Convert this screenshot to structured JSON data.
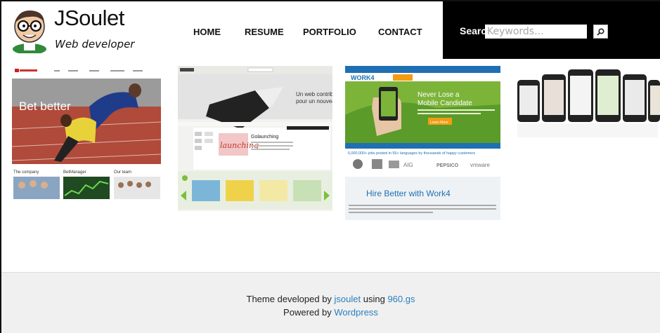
{
  "site": {
    "title": "JSoulet",
    "subtitle": "Web developer"
  },
  "nav": {
    "home": "HOME",
    "resume": "RESUME",
    "portfolio": "PORTFOLIO",
    "contact": "CONTACT"
  },
  "search": {
    "label": "Search:",
    "placeholder": "Keywords...",
    "button_icon": "magnifier-icon"
  },
  "portfolio": {
    "betclic": {
      "slogan": "Bet better",
      "links": [
        "The company",
        "BetManager",
        "Our team"
      ]
    },
    "launching": {
      "headline1": "Un web contributif",
      "headline2": "pour un nouveau modèle",
      "brand": "launching",
      "subtitle": "Golaunching"
    },
    "work4": {
      "logo": "WORK4",
      "hero1": "Never Lose a",
      "hero2": "Mobile Candidate",
      "cta": "Learn More",
      "jobs_text": "6,000,000+ jobs posted in 55+ languages by thousands of happy customers",
      "brand_pepsico": "PEPSICO",
      "brand_vmware": "vmware",
      "brand_aig": "AIG",
      "hire_title": "Hire Better with Work4"
    },
    "mobile": {
      "label": "mobile screens"
    }
  },
  "footer": {
    "line1_prefix": "Theme developed by ",
    "author_link": "jsoulet",
    "line1_mid": " using ",
    "framework_link": "960.gs",
    "line2_prefix": "Powered by ",
    "cms_link": "Wordpress"
  },
  "colors": {
    "search_bg": "#000000",
    "link": "#2a7fc0",
    "footer_bg": "#f0f0f0",
    "work4_green": "#7cb43a",
    "work4_blue": "#1f6fb3"
  }
}
